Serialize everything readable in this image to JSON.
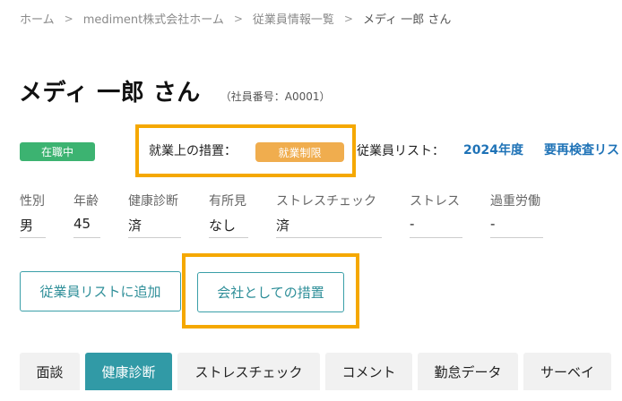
{
  "breadcrumb": {
    "items": [
      "ホーム",
      "mediment株式会社ホーム",
      "従業員情報一覧"
    ],
    "current": "メディ 一郎 さん",
    "separator": ">"
  },
  "header": {
    "title": "メディ 一郎 さん",
    "employee_number": "（社員番号：A0001）"
  },
  "status": {
    "employment_badge": "在職中",
    "measure_label": "就業上の措置：",
    "measure_badge": "就業制限",
    "list_label": "従業員リスト：",
    "list_links": [
      "2024年度",
      "要再検査リスト"
    ]
  },
  "info_fields": [
    {
      "label": "性別",
      "value": "男"
    },
    {
      "label": "年齢",
      "value": "45"
    },
    {
      "label": "健康診断",
      "value": "済"
    },
    {
      "label": "有所見",
      "value": "なし"
    },
    {
      "label": "ストレスチェック",
      "value": "済"
    },
    {
      "label": "ストレス",
      "value": "-"
    },
    {
      "label": "過重労働",
      "value": "-"
    }
  ],
  "actions": {
    "add_to_list_label": "従業員リストに追加",
    "company_measure_label": "会社としての措置"
  },
  "tabs": [
    {
      "label": "面談",
      "active": false
    },
    {
      "label": "健康診断",
      "active": true
    },
    {
      "label": "ストレスチェック",
      "active": false
    },
    {
      "label": "コメント",
      "active": false
    },
    {
      "label": "勤怠データ",
      "active": false
    },
    {
      "label": "サーベイ",
      "active": false
    }
  ],
  "colors": {
    "accent_teal": "#319aa6",
    "status_green": "#3cb371",
    "restriction_orange": "#f0ad4e",
    "highlight_orange": "#f5a800",
    "link_blue": "#1f73b7"
  }
}
